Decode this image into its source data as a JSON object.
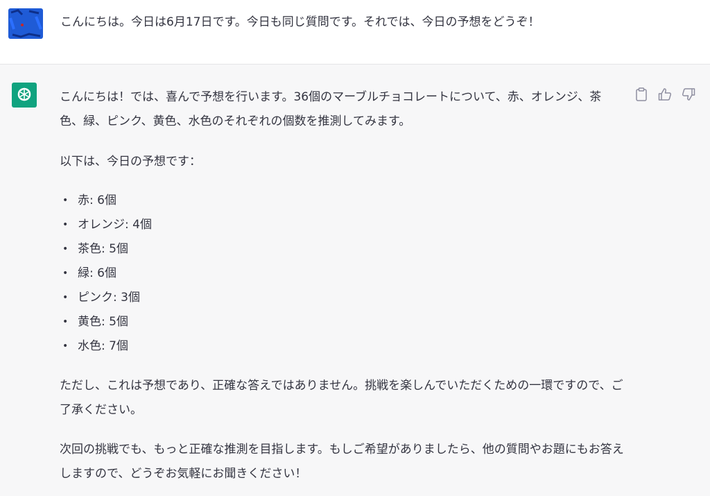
{
  "user_message": {
    "text": "こんにちは。今日は6月17日です。今日も同じ質問です。それでは、今日の予想をどうぞ！",
    "avatar_icon": "user-avatar-scribble"
  },
  "assistant_message": {
    "avatar_icon": "openai-logo-icon",
    "accent_color": "#10a37f",
    "intro": "こんにちは！では、喜んで予想を行います。36個のマーブルチョコレートについて、赤、オレンジ、茶色、緑、ピンク、黄色、水色のそれぞれの個数を推測してみます。",
    "lead": "以下は、今日の予想です：",
    "predictions": [
      {
        "bullet": "•",
        "text": "赤: 6個"
      },
      {
        "bullet": "•",
        "text": "オレンジ: 4個"
      },
      {
        "bullet": "•",
        "text": "茶色: 5個"
      },
      {
        "bullet": "•",
        "text": "緑: 6個"
      },
      {
        "bullet": "•",
        "text": "ピンク: 3個"
      },
      {
        "bullet": "•",
        "text": "黄色: 5個"
      },
      {
        "bullet": "•",
        "text": "水色: 7個"
      }
    ],
    "note": "ただし、これは予想であり、正確な答えではありません。挑戦を楽しんでいただくための一環ですので、ご了承ください。",
    "closing": "次回の挑戦でも、もっと正確な推測を目指します。もしご希望がありましたら、他の質問やお題にもお答えしますので、どうぞお気軽にお聞きください！"
  },
  "actions": [
    {
      "icon": "clipboard-icon"
    },
    {
      "icon": "thumbs-up-icon"
    },
    {
      "icon": "thumbs-down-icon"
    }
  ]
}
